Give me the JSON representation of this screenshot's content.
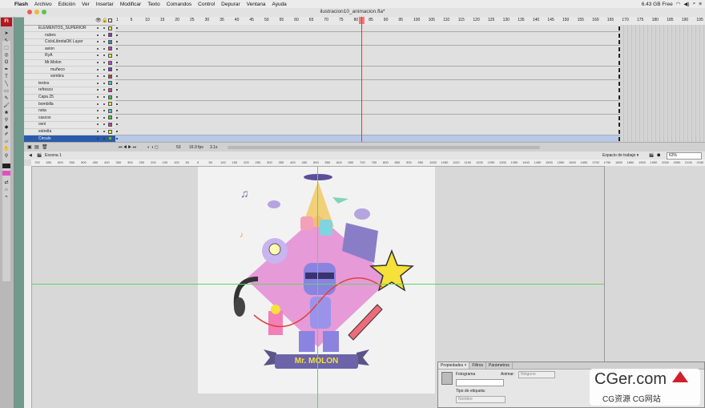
{
  "menubar": {
    "apple": "",
    "items": [
      "Flash",
      "Archivo",
      "Edición",
      "Ver",
      "Insertar",
      "Modificar",
      "Texto",
      "Comandos",
      "Control",
      "Depurar",
      "Ventana",
      "Ayuda"
    ],
    "status": "6.43 GB Free"
  },
  "window": {
    "title": "ilustracion10_animacion.fla*"
  },
  "app_logo": "Fl",
  "layers": [
    {
      "name": "ELEMENTOS_SUPERIOR",
      "indent": 0,
      "color": "#e8e040"
    },
    {
      "name": "nubes",
      "indent": 1,
      "color": "#7a3cc8"
    },
    {
      "name": "CicloLibretaOK Layer",
      "indent": 1,
      "color": "#2a8ad8"
    },
    {
      "name": "avion",
      "indent": 1,
      "color": "#c83c9a"
    },
    {
      "name": "RyA",
      "indent": 1,
      "color": "#e8e040"
    },
    {
      "name": "Mr.Molon",
      "indent": 1,
      "color": "#b64acb"
    },
    {
      "name": "muñeco",
      "indent": 2,
      "color": "#7a3cc8"
    },
    {
      "name": "sombra",
      "indent": 2,
      "color": "#c83c3c"
    },
    {
      "name": "textos",
      "indent": 0,
      "color": "#3cc8c8"
    },
    {
      "name": "refresco",
      "indent": 0,
      "color": "#c83c9a"
    },
    {
      "name": "Capa 25",
      "indent": 0,
      "color": "#3cc83c"
    },
    {
      "name": "bombilla",
      "indent": 0,
      "color": "#e8e040"
    },
    {
      "name": "nota",
      "indent": 0,
      "color": "#3cc8c8"
    },
    {
      "name": "cascos",
      "indent": 0,
      "color": "#3cc83c"
    },
    {
      "name": "ovni",
      "indent": 0,
      "color": "#c83c9a"
    },
    {
      "name": "estrella",
      "indent": 0,
      "color": "#e8e040"
    },
    {
      "name": "Circulo",
      "indent": 0,
      "color": "#3cc83c",
      "selected": true
    }
  ],
  "timeline": {
    "frame_numbers": [
      "1",
      "5",
      "10",
      "15",
      "20",
      "25",
      "30",
      "35",
      "40",
      "45",
      "50",
      "55",
      "60",
      "65",
      "70",
      "75",
      "80",
      "85",
      "90",
      "95",
      "100",
      "105",
      "110",
      "115",
      "120",
      "125",
      "130",
      "135",
      "140",
      "145",
      "150",
      "155",
      "160",
      "165",
      "170",
      "175",
      "180",
      "185",
      "190",
      "195"
    ],
    "current_frame": "53",
    "fps": "16.9 fps",
    "time": "3.1s"
  },
  "scene": {
    "label": "Escena 1",
    "workspace": "Espacio de trabajo ▾",
    "zoom": "63%"
  },
  "ruler_labels": [
    "700",
    "650",
    "600",
    "550",
    "500",
    "450",
    "400",
    "350",
    "300",
    "250",
    "200",
    "150",
    "100",
    "50",
    "0",
    "50",
    "100",
    "150",
    "200",
    "250",
    "300",
    "350",
    "400",
    "450",
    "500",
    "550",
    "600",
    "650",
    "700",
    "750",
    "800",
    "850",
    "900",
    "950",
    "1000",
    "1050",
    "1100",
    "1150",
    "1200",
    "1250",
    "1300",
    "1350",
    "1400",
    "1450",
    "1500",
    "1550",
    "1600",
    "1650",
    "1700",
    "1750",
    "1800",
    "1850",
    "1900",
    "1950",
    "2000",
    "2050",
    "2100",
    "2150"
  ],
  "illustration_text": "Mr. MOLON",
  "properties": {
    "tabs": [
      "Propiedades ×",
      "Filtros",
      "Parámetros"
    ],
    "frame_label": "Fotograma",
    "animate_label": "Animar:",
    "animate_value": "Ninguno",
    "label_type": "Tipo de etiqueta:",
    "label_type_value": "Nombre"
  },
  "watermark": {
    "main": "CGer.com",
    "sub": "CG资源 CG网站"
  }
}
